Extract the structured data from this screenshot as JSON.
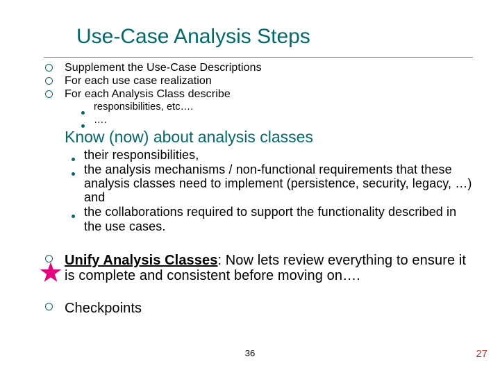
{
  "title": "Use-Case Analysis Steps",
  "bullets": {
    "b1": "Supplement the Use-Case Descriptions",
    "b2": "For each use case realization",
    "b3": "For each Analysis Class describe",
    "b3a": "responsibilities, etc….",
    "b3b": "…."
  },
  "heading2": "Know (now) about analysis classes",
  "know": {
    "k1": "their responsibilities,",
    "k2": "the analysis mechanisms / non-functional requirements that these analysis classes need to implement (persistence, security, legacy, …)  and",
    "k3": "the collaborations required to support the functionality described in the use cases."
  },
  "unify": {
    "lead": "Unify Analysis Classes",
    "rest": ":   Now lets review everything to ensure it is complete and consistent before moving on…."
  },
  "checkpoints": "Checkpoints",
  "pagenum_center": "36",
  "pagenum_right": "27"
}
